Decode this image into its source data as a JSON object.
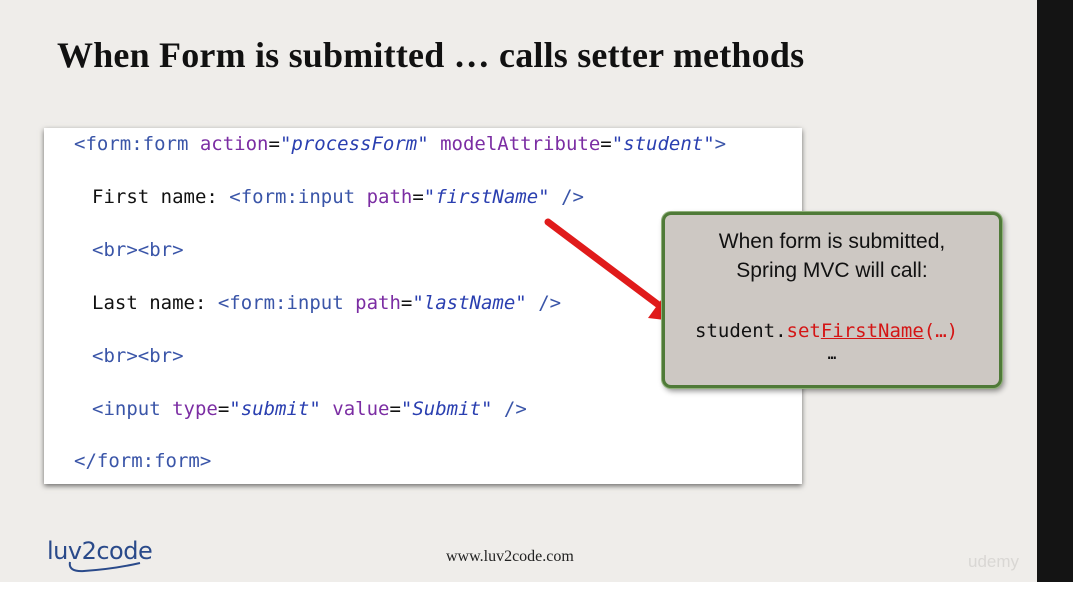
{
  "slide": {
    "title": "When Form is submitted … calls setter methods",
    "code_lines": [
      {
        "segments": [
          {
            "cls": "tag",
            "text": "<form:form "
          },
          {
            "cls": "attr",
            "text": "action"
          },
          {
            "cls": "eq",
            "text": "="
          },
          {
            "cls": "val",
            "text": "\"processForm\""
          },
          {
            "cls": "plain",
            "text": " "
          },
          {
            "cls": "attr",
            "text": "modelAttribute"
          },
          {
            "cls": "eq",
            "text": "="
          },
          {
            "cls": "val",
            "text": "\"student\""
          },
          {
            "cls": "tag",
            "text": ">"
          }
        ]
      },
      {
        "segments": [
          {
            "cls": "plain",
            "text": "First name: "
          },
          {
            "cls": "tag",
            "text": "<form:input "
          },
          {
            "cls": "attr",
            "text": "path"
          },
          {
            "cls": "eq",
            "text": "="
          },
          {
            "cls": "val",
            "text": "\"firstName\""
          },
          {
            "cls": "plain",
            "text": " "
          },
          {
            "cls": "tag",
            "text": "/>"
          }
        ]
      },
      {
        "segments": [
          {
            "cls": "tag",
            "text": "<br><br>"
          }
        ]
      },
      {
        "segments": [
          {
            "cls": "plain",
            "text": "Last name: "
          },
          {
            "cls": "tag",
            "text": "<form:input "
          },
          {
            "cls": "attr",
            "text": "path"
          },
          {
            "cls": "eq",
            "text": "="
          },
          {
            "cls": "val",
            "text": "\"lastName\""
          },
          {
            "cls": "plain",
            "text": " "
          },
          {
            "cls": "tag",
            "text": "/>"
          }
        ]
      },
      {
        "segments": [
          {
            "cls": "tag",
            "text": "<br><br>"
          }
        ]
      },
      {
        "segments": [
          {
            "cls": "tag",
            "text": "<input "
          },
          {
            "cls": "attr",
            "text": "type"
          },
          {
            "cls": "eq",
            "text": "="
          },
          {
            "cls": "val",
            "text": "\"submit\""
          },
          {
            "cls": "plain",
            "text": " "
          },
          {
            "cls": "attr",
            "text": "value"
          },
          {
            "cls": "eq",
            "text": "="
          },
          {
            "cls": "val",
            "text": "\"Submit\""
          },
          {
            "cls": "plain",
            "text": " "
          },
          {
            "cls": "tag",
            "text": "/>"
          }
        ]
      },
      {
        "segments": [
          {
            "cls": "tag",
            "text": "</form:form>"
          }
        ]
      }
    ],
    "callout": {
      "line1": "When form is submitted,",
      "line2": "Spring MVC will call:",
      "call_object": "student.",
      "call_prefix": "set",
      "call_method": "FirstName",
      "call_args": "(…)",
      "ellipsis": "…"
    },
    "logo_text": "luv2code",
    "footer_url": "www.luv2code.com",
    "watermark": "udemy",
    "colors": {
      "tag": "#3a55a8",
      "attribute": "#7b2da3",
      "value": "#2a3fb0",
      "highlight": "#d41515",
      "callout_border": "#4f7a38"
    }
  }
}
